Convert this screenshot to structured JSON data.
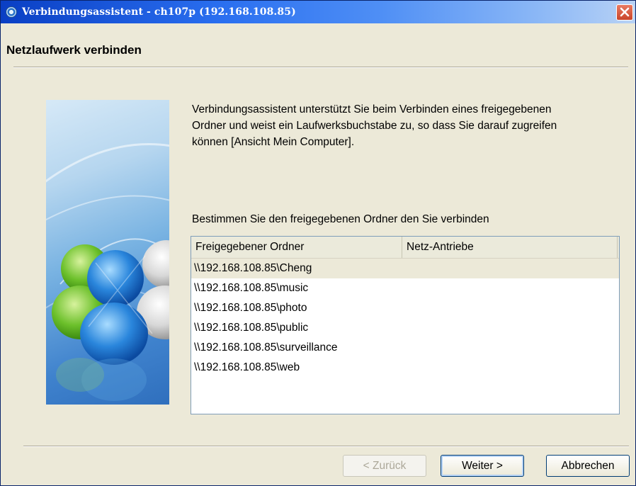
{
  "window": {
    "title": "Verbindungsassistent - ch107p (192.168.108.85)"
  },
  "header": {
    "title": "Netzlaufwerk verbinden"
  },
  "intro": {
    "text": "Verbindungsassistent unterstützt Sie beim Verbinden eines freigegebenen Ordner und weist ein Laufwerksbuchstabe zu, so dass Sie darauf zugreifen können [Ansicht Mein Computer]."
  },
  "list": {
    "label": "Bestimmen Sie den freigegebenen Ordner den Sie verbinden",
    "columns": [
      "Freigegebener Ordner",
      "Netz-Antriebe"
    ],
    "rows": [
      "\\\\192.168.108.85\\Cheng",
      "\\\\192.168.108.85\\music",
      "\\\\192.168.108.85\\photo",
      "\\\\192.168.108.85\\public",
      "\\\\192.168.108.85\\surveillance",
      "\\\\192.168.108.85\\web"
    ],
    "selected_row": 0
  },
  "buttons": {
    "back": "< Zurück",
    "next": "Weiter >",
    "cancel": "Abbrechen"
  },
  "icons": {
    "app": "network-globe-icon",
    "close": "close-icon",
    "illustration": "users-illustration"
  },
  "colors": {
    "titlebar": "#0a3fc4",
    "close": "#d4553a",
    "dialog_bg": "#ece9d8",
    "selection": "#ece9d8"
  }
}
